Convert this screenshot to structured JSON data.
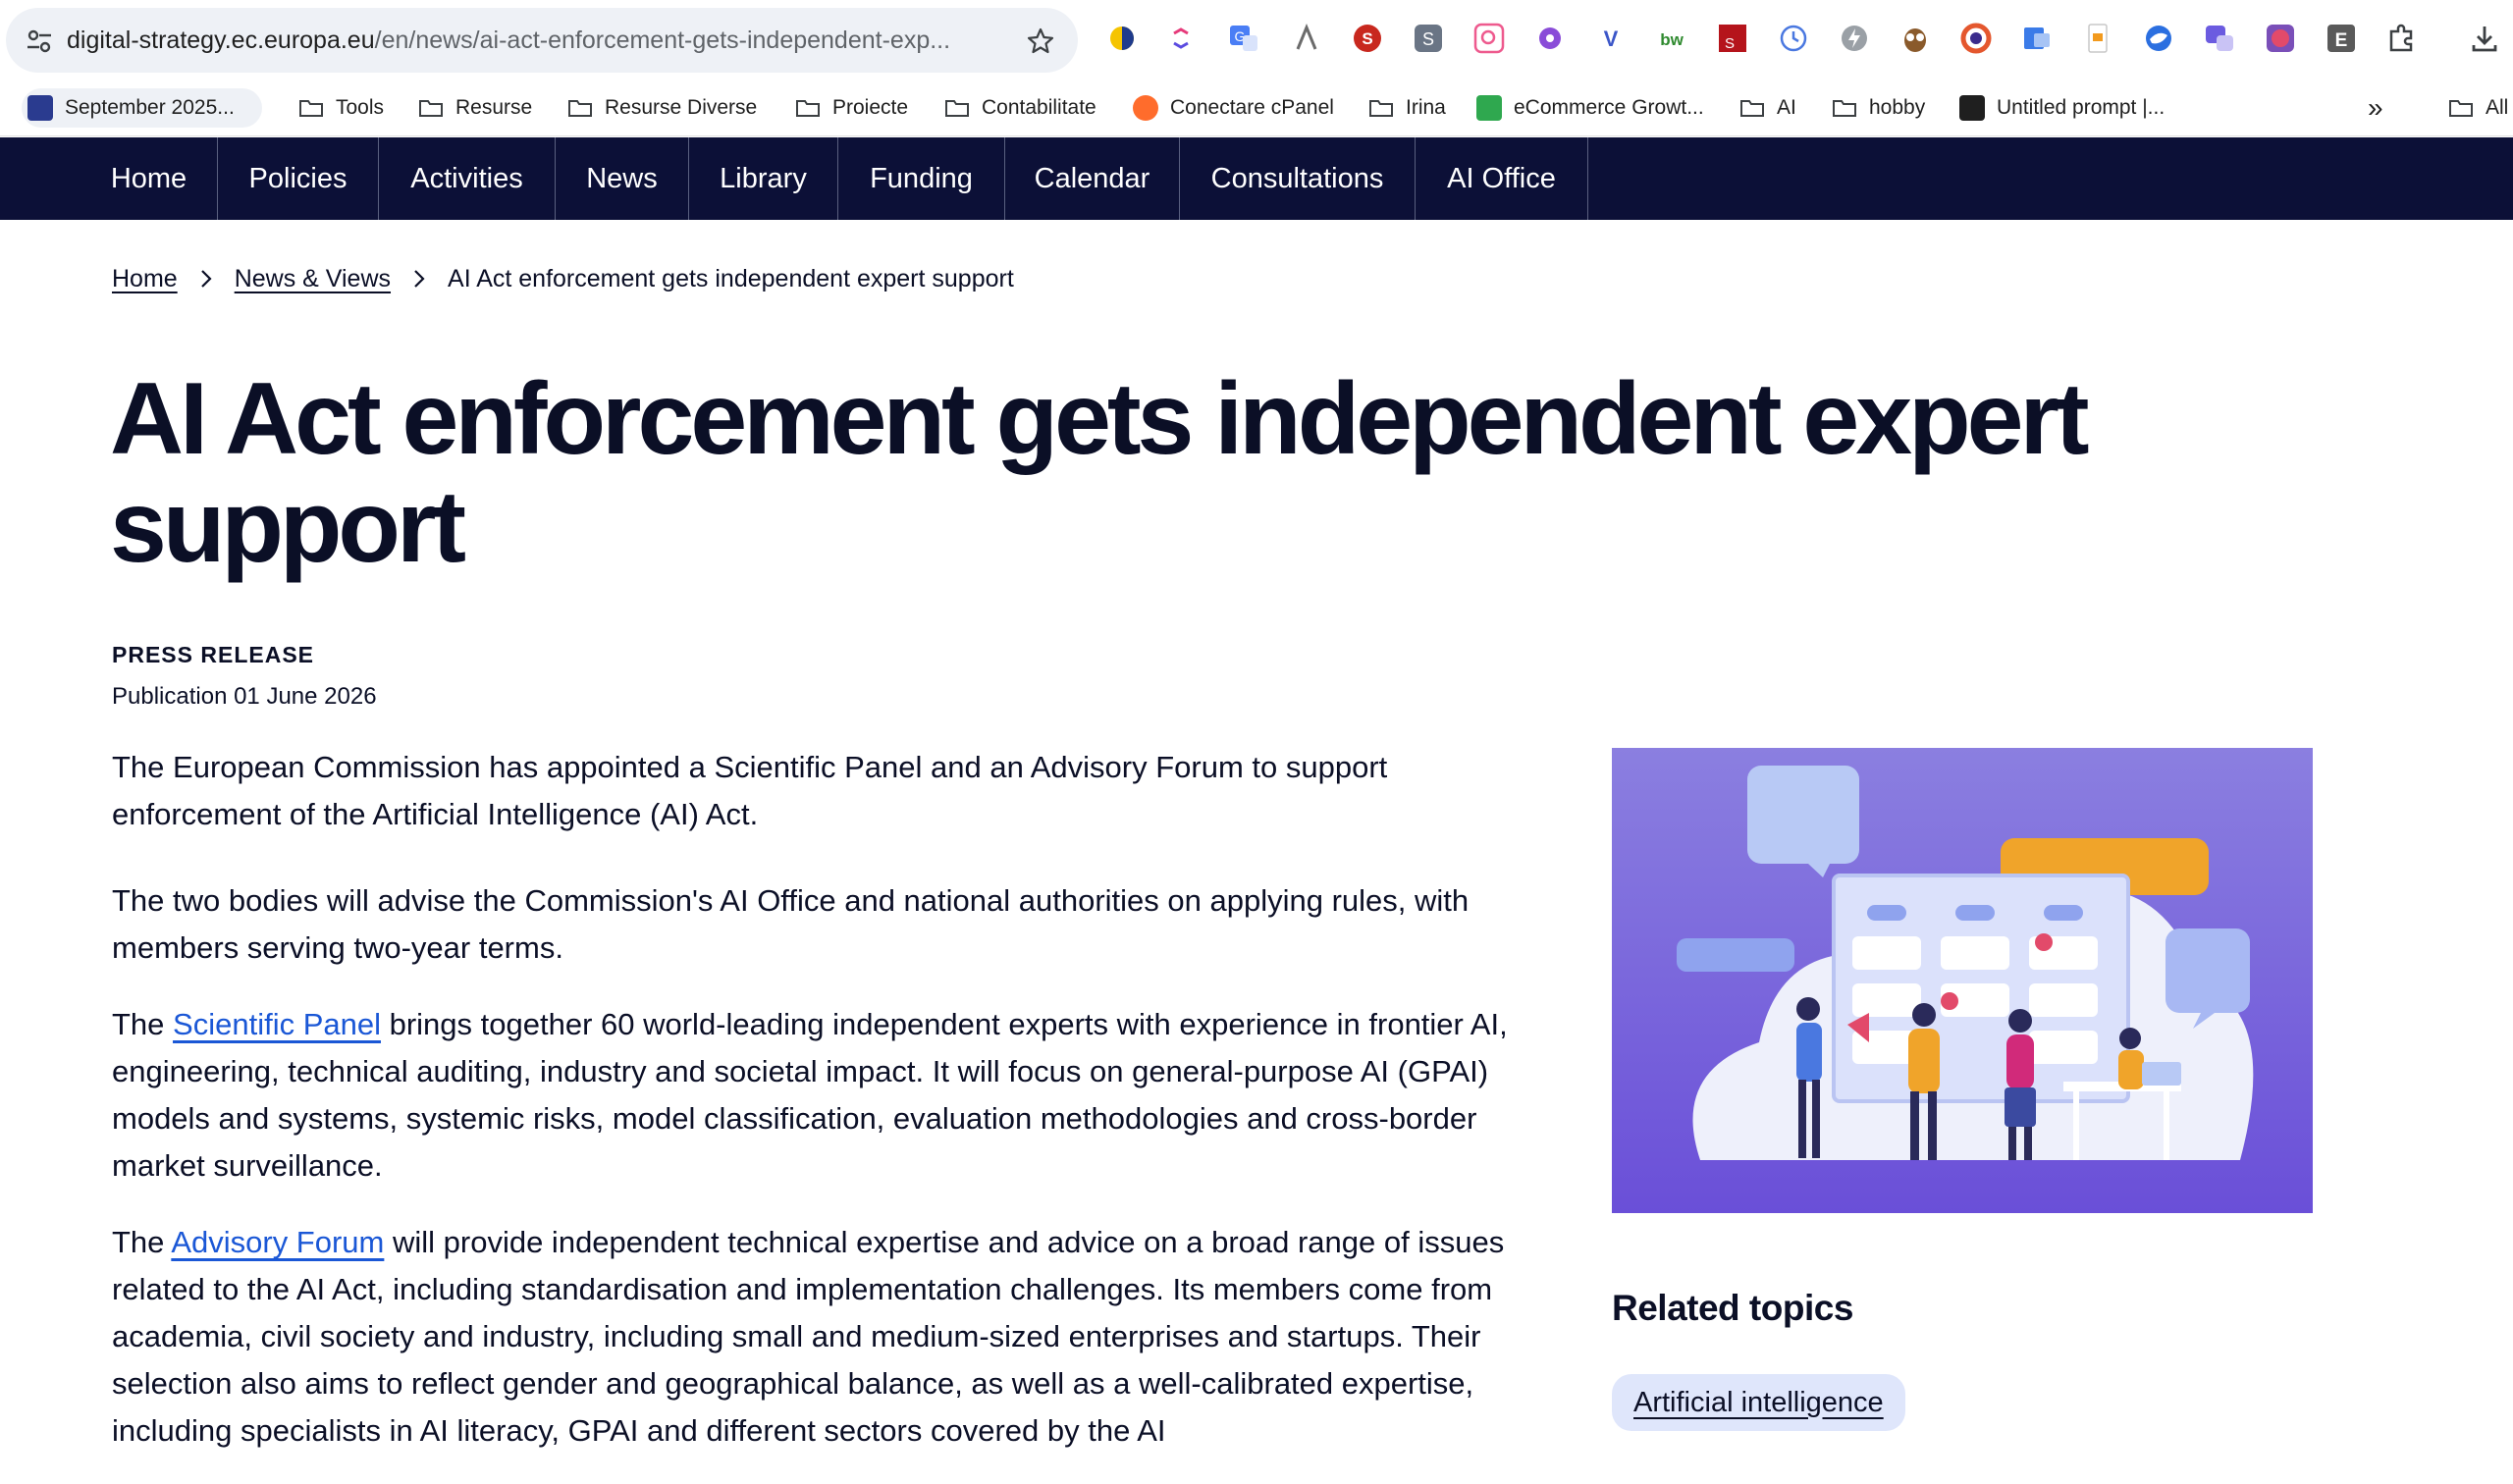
{
  "browser": {
    "url_host": "digital-strategy.ec.europa.eu",
    "url_path": "/en/news/ai-act-enforcement-gets-independent-exp...",
    "bookmarks": [
      {
        "label": "September 2025...",
        "type": "pill"
      },
      {
        "label": "Tools",
        "type": "folder"
      },
      {
        "label": "Resurse",
        "type": "folder"
      },
      {
        "label": "Resurse Diverse",
        "type": "folder"
      },
      {
        "label": "Proiecte",
        "type": "folder"
      },
      {
        "label": "Contabilitate",
        "type": "folder"
      },
      {
        "label": "Conectare cPanel",
        "type": "site"
      },
      {
        "label": "Irina",
        "type": "folder"
      },
      {
        "label": "eCommerce Growt...",
        "type": "site"
      },
      {
        "label": "AI",
        "type": "folder"
      },
      {
        "label": "hobby",
        "type": "folder"
      },
      {
        "label": "Untitled prompt |...",
        "type": "site"
      },
      {
        "label": "All",
        "type": "folder"
      }
    ],
    "overflow_label": "»",
    "colors": {
      "nav_bg": "#0c1037",
      "link": "#1a57d6",
      "chip_bg": "#dfe6fb"
    }
  },
  "nav": {
    "items": [
      "Home",
      "Policies",
      "Activities",
      "News",
      "Library",
      "Funding",
      "Calendar",
      "Consultations",
      "AI Office"
    ]
  },
  "breadcrumb": {
    "home": "Home",
    "section": "News & Views",
    "current": "AI Act enforcement gets independent expert support"
  },
  "article": {
    "title": "AI Act enforcement gets independent expert support",
    "kicker": "PRESS RELEASE",
    "publication": "Publication 01 June 2026",
    "lead": "The European Commission has appointed a Scientific Panel and an Advisory Forum to support enforcement of the Artificial Intelligence (AI) Act.",
    "p1": "The two bodies will advise the Commission's AI Office and national authorities on applying rules, with members serving two-year terms.",
    "p2_pre": "The ",
    "p2_link": "Scientific Panel",
    "p2_post": " brings together 60 world-leading independent experts with experience in frontier AI, engineering, technical auditing, industry and societal impact. It will focus on general-purpose AI (GPAI) models and systems, systemic risks, model classification, evaluation methodologies and cross-border market surveillance.",
    "p3_pre": "The ",
    "p3_link": "Advisory Forum",
    "p3_post": " will provide independent technical expertise and advice on a broad range of issues related to the AI Act, including standardisation and implementation challenges. Its members come from academia, civil society and industry, including small and medium-sized enterprises and startups. Their selection also aims to reflect gender and geographical balance, as well as a well-calibrated expertise, including specialists in AI literacy, GPAI and different sectors covered by the AI"
  },
  "sidebar": {
    "related_title": "Related topics",
    "topics": [
      "Artificial intelligence"
    ]
  }
}
